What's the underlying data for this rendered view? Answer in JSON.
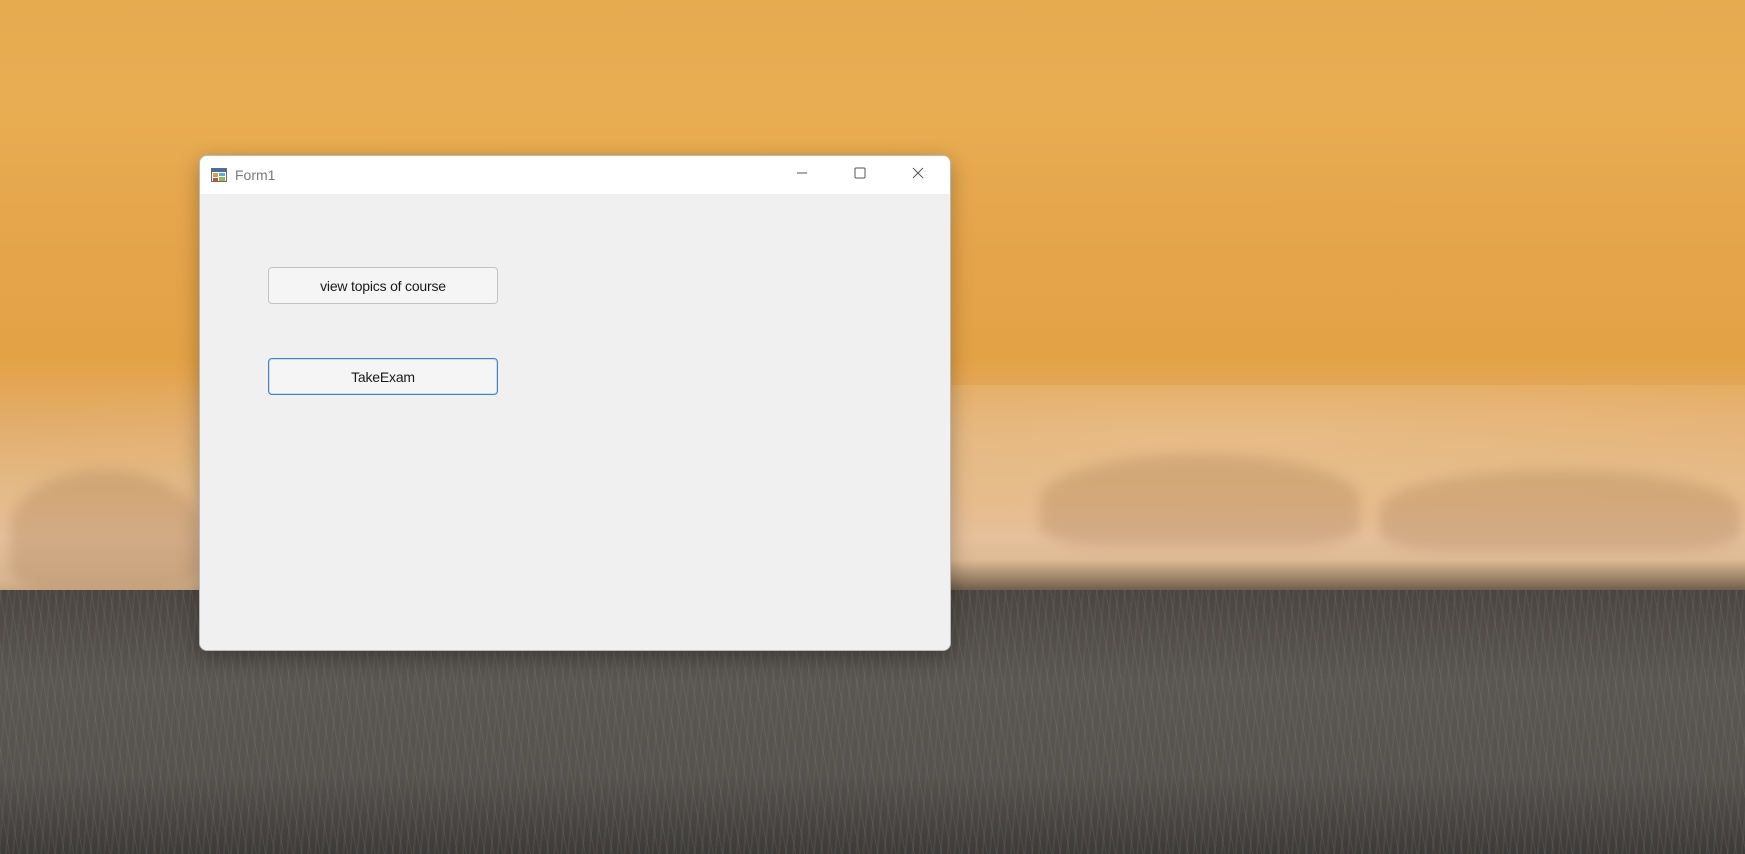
{
  "window": {
    "title": "Form1",
    "icon": "winforms-app-icon",
    "controls": {
      "minimize": "minimize-icon",
      "maximize": "maximize-icon",
      "close": "close-icon"
    }
  },
  "form": {
    "buttons": [
      {
        "label": "view topics of course",
        "focused": false
      },
      {
        "label": "TakeExam",
        "focused": true
      }
    ]
  },
  "colors": {
    "client_background": "#f0f0f0",
    "titlebar_background": "#ffffff",
    "focus_border": "#3f82c8",
    "title_text": "#7a7a7a"
  }
}
